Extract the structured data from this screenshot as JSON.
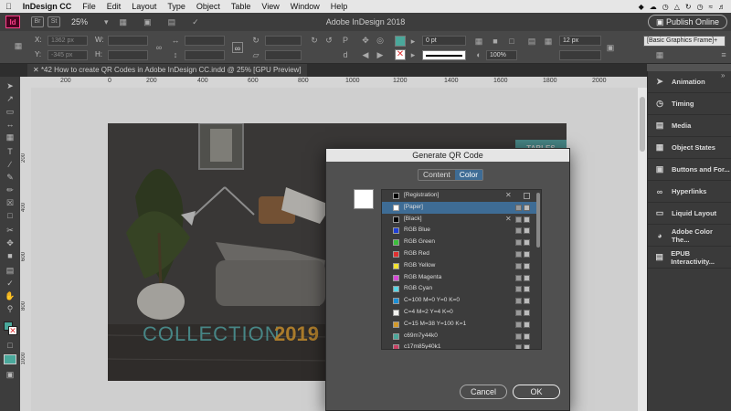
{
  "menubar": {
    "apple": "",
    "app_name": "InDesign CC",
    "items": [
      "File",
      "Edit",
      "Layout",
      "Type",
      "Object",
      "Table",
      "View",
      "Window",
      "Help"
    ],
    "status_icons": [
      "dropbox-icon",
      "creative-cloud-icon",
      "time-machine-icon",
      "drive-icon",
      "sync-icon",
      "clock-icon",
      "wifi-icon",
      "volume-icon"
    ]
  },
  "appbar": {
    "br_label": "Br",
    "st_label": "St",
    "zoom": "25%",
    "window_title": "Adobe InDesign 2018",
    "publish_label": "Publish Online"
  },
  "control": {
    "x_label": "X:",
    "x_value": "1362 px",
    "y_label": "Y:",
    "y_value": "-345 px",
    "w_label": "W:",
    "h_label": "H:",
    "stroke_weight": "0 pt",
    "opacity": "100%",
    "spacing": "12 px",
    "style": "[Basic Graphics Frame]+"
  },
  "document": {
    "tab_title": "*42 How to create QR Codes in Adobe InDesign CC.indd @ 25% [GPU Preview]"
  },
  "ruler": {
    "h_marks": [
      "200",
      "0",
      "200",
      "400",
      "600",
      "800",
      "1000",
      "1200",
      "1400",
      "1600",
      "1800",
      "2000"
    ],
    "v_marks": [
      "200",
      "400",
      "600",
      "800",
      "1000"
    ]
  },
  "artwork": {
    "collection": "COLLECTION",
    "year": "2019",
    "tables_tag": "TABLES",
    "teal": "#5fb3b3",
    "gold": "#e3a53a"
  },
  "panels": [
    {
      "label": "Animation",
      "icon": "animation-icon"
    },
    {
      "label": "Timing",
      "icon": "timing-icon"
    },
    {
      "label": "Media",
      "icon": "media-icon"
    },
    {
      "label": "Object States",
      "icon": "object-states-icon"
    },
    {
      "label": "Buttons and For...",
      "icon": "buttons-forms-icon"
    },
    {
      "label": "Hyperlinks",
      "icon": "hyperlinks-icon"
    },
    {
      "label": "Liquid Layout",
      "icon": "liquid-layout-icon"
    },
    {
      "label": "Adobe Color The...",
      "icon": "adobe-color-themes-icon"
    },
    {
      "label": "EPUB Interactivity...",
      "icon": "epub-interactivity-icon"
    }
  ],
  "dialog": {
    "title": "Generate QR Code",
    "tab_content": "Content",
    "tab_color": "Color",
    "cancel": "Cancel",
    "ok": "OK",
    "swatches": [
      {
        "name": "[Registration]",
        "color": "#000000",
        "pen": true,
        "sel": false
      },
      {
        "name": "[Paper]",
        "color": "#ffffff",
        "pen": false,
        "sel": true
      },
      {
        "name": "[Black]",
        "color": "#000000",
        "pen": true,
        "sel": false
      },
      {
        "name": "RGB Blue",
        "color": "#1f3fd6",
        "pen": false,
        "sel": false
      },
      {
        "name": "RGB Green",
        "color": "#3bbf3b",
        "pen": false,
        "sel": false
      },
      {
        "name": "RGB Red",
        "color": "#e03030",
        "pen": false,
        "sel": false
      },
      {
        "name": "RGB Yellow",
        "color": "#f2e230",
        "pen": false,
        "sel": false
      },
      {
        "name": "RGB Magenta",
        "color": "#d64bd6",
        "pen": false,
        "sel": false
      },
      {
        "name": "RGB Cyan",
        "color": "#5ad6e6",
        "pen": false,
        "sel": false
      },
      {
        "name": "C=100 M=0 Y=0 K=0",
        "color": "#1b8fd6",
        "pen": false,
        "sel": false
      },
      {
        "name": "C=4 M=2 Y=4 K=0",
        "color": "#f2f2ef",
        "pen": false,
        "sel": false
      },
      {
        "name": "C=15 M=38 Y=100 K=1",
        "color": "#d39a2a",
        "pen": false,
        "sel": false
      },
      {
        "name": "c69m7y44k0",
        "color": "#4aa89b",
        "pen": false,
        "sel": false
      },
      {
        "name": "c17m85y40k1",
        "color": "#c94063",
        "pen": false,
        "sel": false
      }
    ]
  }
}
